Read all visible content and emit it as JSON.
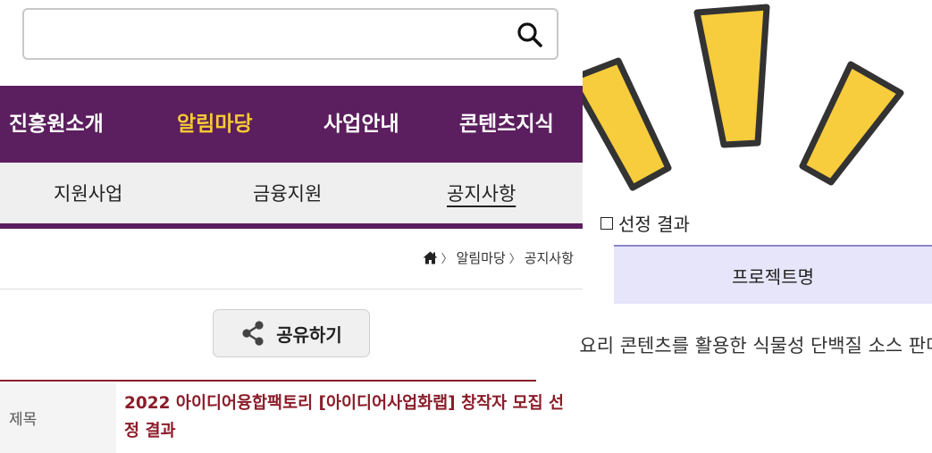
{
  "search": {
    "value": "",
    "placeholder": ""
  },
  "main_nav": {
    "items": [
      {
        "label": "진흥원소개",
        "active": false
      },
      {
        "label": "알림마당",
        "active": true
      },
      {
        "label": "사업안내",
        "active": false
      },
      {
        "label": "콘텐츠지식",
        "active": false
      }
    ]
  },
  "sub_nav": {
    "items": [
      {
        "label": "지원사업",
        "current": false
      },
      {
        "label": "금융지원",
        "current": false
      },
      {
        "label": "공지사항",
        "current": true
      }
    ]
  },
  "breadcrumb": {
    "items": [
      "알림마당",
      "공지사항"
    ]
  },
  "share": {
    "label": "공유하기"
  },
  "post": {
    "title_label": "제목",
    "title": "2022 아이디어융합팩토리 [아이디어사업화랩] 창작자 모집 선정 결과"
  },
  "result": {
    "heading": "선정 결과",
    "column_header": "프로젝트명",
    "rows": [
      "요리 콘텐츠를 활용한 식물성 단백질 소스 판매"
    ]
  },
  "colors": {
    "nav_purple": "#5b1e5e",
    "nav_active": "#f5c935",
    "title_red": "#8b1d2a",
    "table_header_bg": "#e7e5f9",
    "burst_yellow": "#f7cc3d"
  },
  "icons": [
    "search-icon",
    "home-icon",
    "share-icon",
    "checkbox-icon"
  ]
}
